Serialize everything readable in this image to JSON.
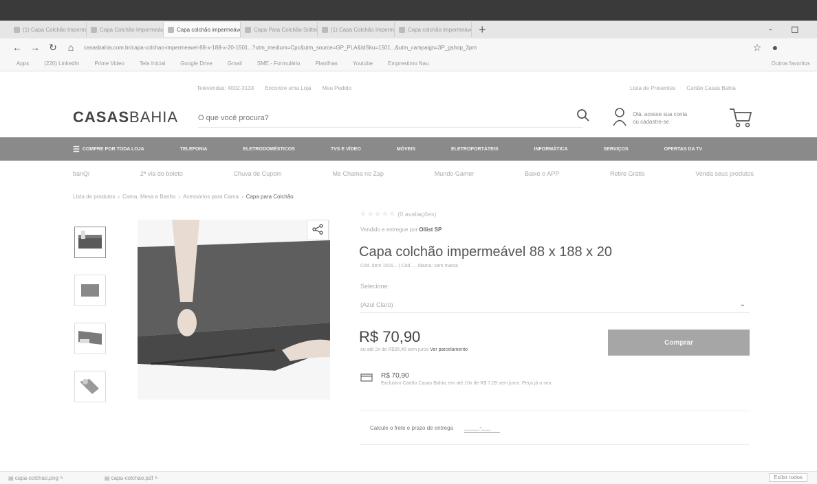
{
  "browser": {
    "tabs": [
      {
        "label": "(1) Capa Colchão Impermea"
      },
      {
        "label": "Capa Colchão Impermeável"
      },
      {
        "label": "Capa colchão impermeável"
      },
      {
        "label": "Capa Para Colchão Solteiro"
      },
      {
        "label": "(1) Capa Colchão Impermea"
      },
      {
        "label": "Capa colchão impermeável"
      }
    ],
    "active_tab_index": 2,
    "new_tab": "+",
    "url": "casasbahia.com.br/capa-colchao-impermeavel-88-x-188-x-20-1501...?utm_medium=Cpc&utm_source=GP_PLA&IdSku=1501...&utm_campaign=3P_gshop_3pm",
    "bookmarks": [
      "Apps",
      "(220) LinkedIn",
      "Prime Video",
      "Tela Inicial",
      "Google Drive",
      "Gmail",
      "SME - Formulário",
      "Planilhas",
      "Youtube",
      "Emprestimo Nau"
    ],
    "bookmarks_right": "Outros favoritos",
    "window_controls": {
      "minimize": "-",
      "maximize": "◻"
    }
  },
  "header": {
    "util_left": [
      "Televendas: 4002-3133",
      "Encontre uma Loja",
      "Meu Pedido"
    ],
    "util_right": [
      "Lista de Presentes",
      "Cartão Casas Bahia"
    ],
    "logo_bold": "CASAS",
    "logo_light": "BAHIA",
    "search_placeholder": "O que você procura?",
    "account_line1": "Olá, acesse sua conta",
    "account_line2": "ou cadastre-se"
  },
  "nav": {
    "items": [
      "Compre por toda loja",
      "Telefonia",
      "Eletrodomésticos",
      "TVs e Vídeo",
      "Móveis",
      "Eletroportáteis",
      "Informática",
      "Serviços",
      "Ofertas da TV"
    ]
  },
  "subnav": {
    "items": [
      "banQi",
      "2ª via do boleto",
      "Chuva de Cupom",
      "Me Chama no Zap",
      "Mundo Gamer",
      "Baixe o APP",
      "Retire Grátis",
      "Venda seus produtos"
    ]
  },
  "breadcrumb": [
    "Lista de produtos",
    "Cama, Mesa e Banho",
    "Acessórios para Cama",
    "Capa para Colchão"
  ],
  "product": {
    "rating_text": "(0 avaliações)",
    "seller_prefix": "Vendido e entregue por",
    "seller": "Ollist SP",
    "title": "Capa colchão impermeável 88 x 188 x 20",
    "sku": "Cód. Item 1501... | Cód. ... Marca: sem marca",
    "selection_label": "Selecione:",
    "selected_option": "(Azul Claro)",
    "price": "R$ 70,90",
    "installments_text": "ou até 2x de R$35,45 sem juros",
    "installments_link": "Ver parcelamento",
    "buy_label": "Comprar",
    "card_price": "R$ 70,90",
    "card_desc": "Exclusivo Cartão Casas Bahia, em até 10x de R$ 7,09 sem juros. Peça já o seu",
    "freight_label": "Calcule o frete e prazo de entrega",
    "cep_placeholder": "_____-___"
  },
  "downloads": {
    "items": [
      "capa-colchao.png",
      "capa-colchao.pdf"
    ],
    "show_all": "Exibir todos"
  }
}
